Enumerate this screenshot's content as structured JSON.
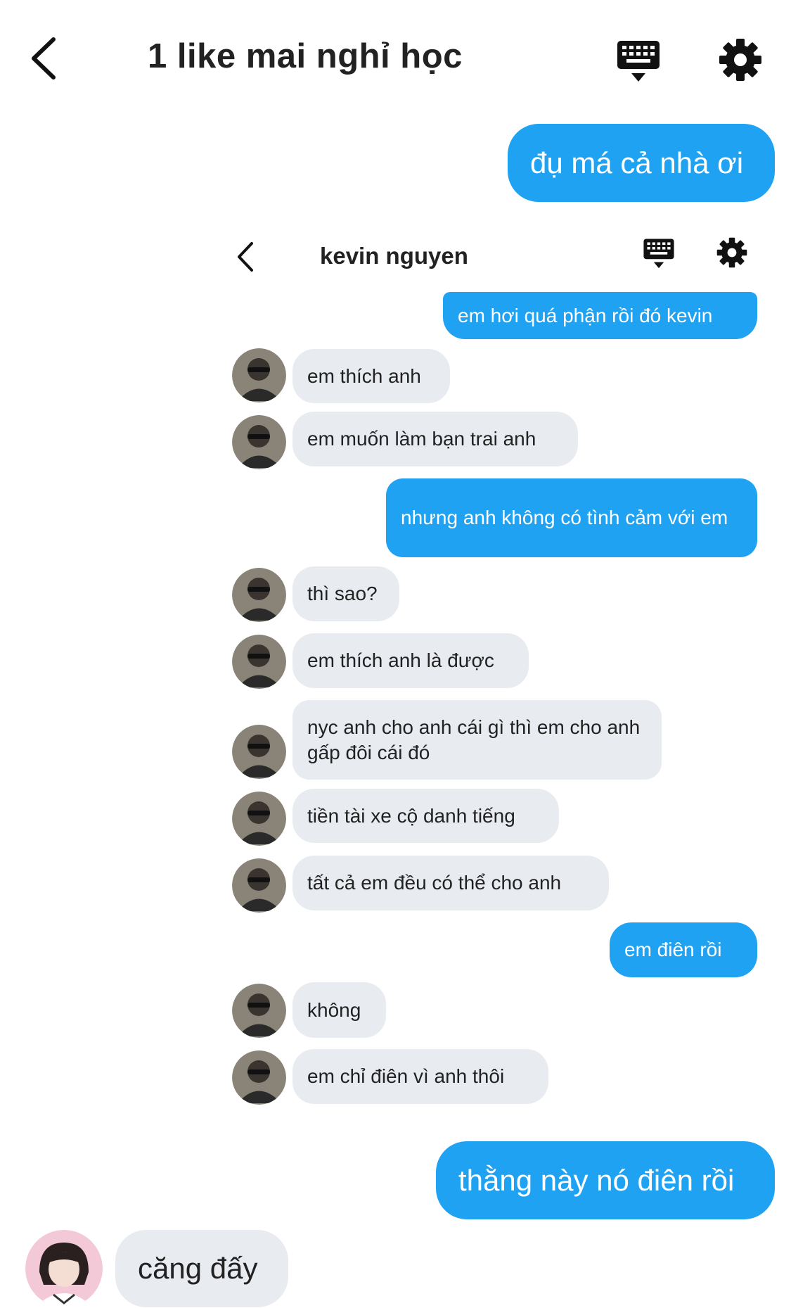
{
  "header": {
    "title": "1 like mai nghỉ học"
  },
  "outer_messages": {
    "m1": "đụ má cả nhà ơi",
    "m2": "thằng này nó điên rồi",
    "m3": "căng đấy"
  },
  "inner_chat": {
    "title": "kevin nguyen",
    "messages": [
      {
        "side": "out",
        "text": "em hơi quá phận rồi đó kevin"
      },
      {
        "side": "in",
        "text": "em thích anh"
      },
      {
        "side": "in",
        "text": "em muốn làm bạn trai anh"
      },
      {
        "side": "out",
        "text": "nhưng anh không có tình cảm với em"
      },
      {
        "side": "in",
        "text": "thì sao?"
      },
      {
        "side": "in",
        "text": "em thích anh là được"
      },
      {
        "side": "in",
        "text": "nyc anh cho anh cái gì thì em cho anh gấp đôi cái đó"
      },
      {
        "side": "in",
        "text": "tiền tài xe cộ danh tiếng"
      },
      {
        "side": "in",
        "text": "tất cả em đều có thể cho anh"
      },
      {
        "side": "out",
        "text": "em điên rồi"
      },
      {
        "side": "in",
        "text": "không"
      },
      {
        "side": "in",
        "text": "em chỉ điên vì anh thôi"
      }
    ]
  },
  "colors": {
    "outgoing": "#1fa2f2",
    "incoming": "#e8ebf0",
    "text_dark": "#222222"
  },
  "icons": {
    "back": "chevron-left-icon",
    "keyboard": "keyboard-icon",
    "settings": "gear-icon"
  }
}
